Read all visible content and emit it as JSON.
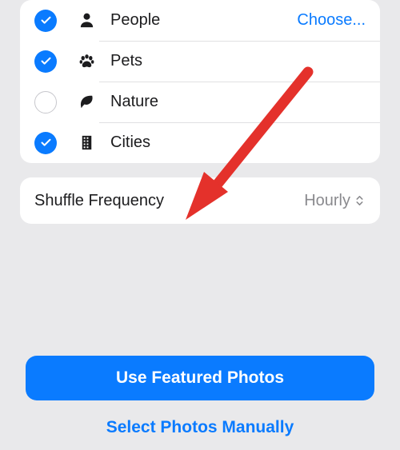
{
  "categories": {
    "items": [
      {
        "label": "People",
        "checked": true,
        "icon": "person-icon",
        "action": "Choose..."
      },
      {
        "label": "Pets",
        "checked": true,
        "icon": "paw-icon"
      },
      {
        "label": "Nature",
        "checked": false,
        "icon": "leaf-icon"
      },
      {
        "label": "Cities",
        "checked": true,
        "icon": "building-icon"
      }
    ]
  },
  "shuffle": {
    "label": "Shuffle Frequency",
    "value": "Hourly"
  },
  "buttons": {
    "primary": "Use Featured Photos",
    "secondary": "Select Photos Manually"
  },
  "colors": {
    "accent": "#0a7bff",
    "arrow": "#e4312b"
  }
}
